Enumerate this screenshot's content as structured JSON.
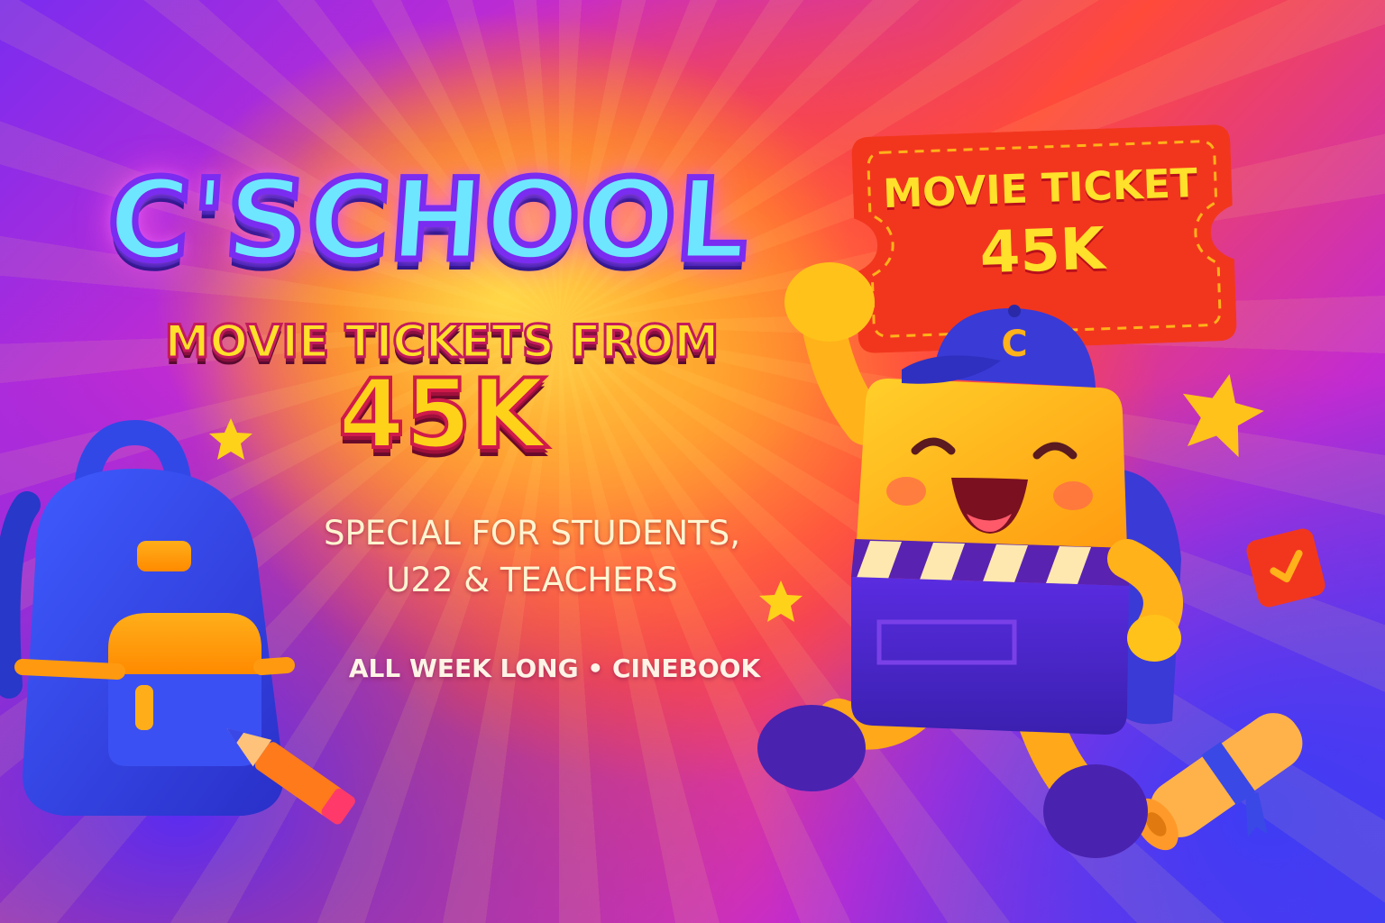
{
  "headline": "C'SCHOOL",
  "subheadline": "MOVIE TICKETS FROM",
  "price": "45K",
  "tagline": {
    "line1": "SPECIAL FOR STUDENTS,",
    "line2": "U22 & TEACHERS"
  },
  "footer": "ALL WEEK LONG • CINEBOOK",
  "ticket": {
    "line1": "MOVIE TICKET",
    "line2": "45K"
  },
  "mascot": {
    "cap_letter": "C"
  },
  "colors": {
    "accent_yellow": "#ffe02a",
    "accent_cyan": "#6fe6ff",
    "ticket_red": "#f2361e",
    "backpack_blue": "#2f4bf0"
  },
  "icons": {
    "backpack": "backpack-icon",
    "pencil": "pencil-icon",
    "diploma": "diploma-scroll-icon",
    "checkbox": "checkbox-icon",
    "star": "star-icon"
  }
}
